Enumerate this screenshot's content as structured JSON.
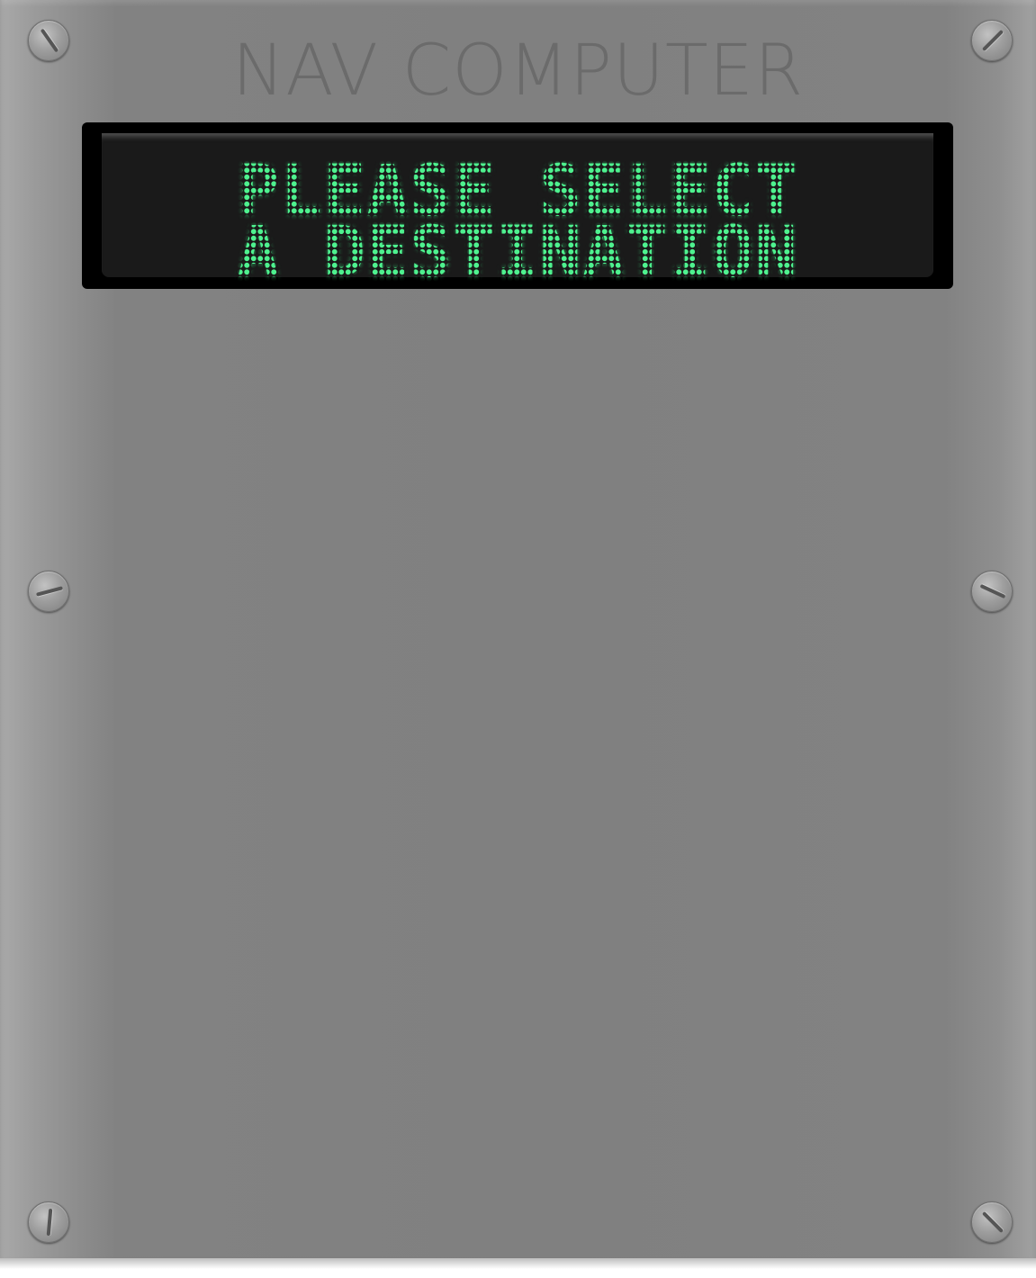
{
  "panel": {
    "title": "NAV COMPUTER"
  },
  "display": {
    "line1": "PLEASE SELECT",
    "line2": "A DESTINATION",
    "text_color": "#4ef28f",
    "background_color": "#1a1a1a"
  },
  "screws": [
    {
      "name": "screw-top-left-icon"
    },
    {
      "name": "screw-top-right-icon"
    },
    {
      "name": "screw-mid-left-icon"
    },
    {
      "name": "screw-mid-right-icon"
    },
    {
      "name": "screw-bottom-left-icon"
    },
    {
      "name": "screw-bottom-right-icon"
    }
  ]
}
